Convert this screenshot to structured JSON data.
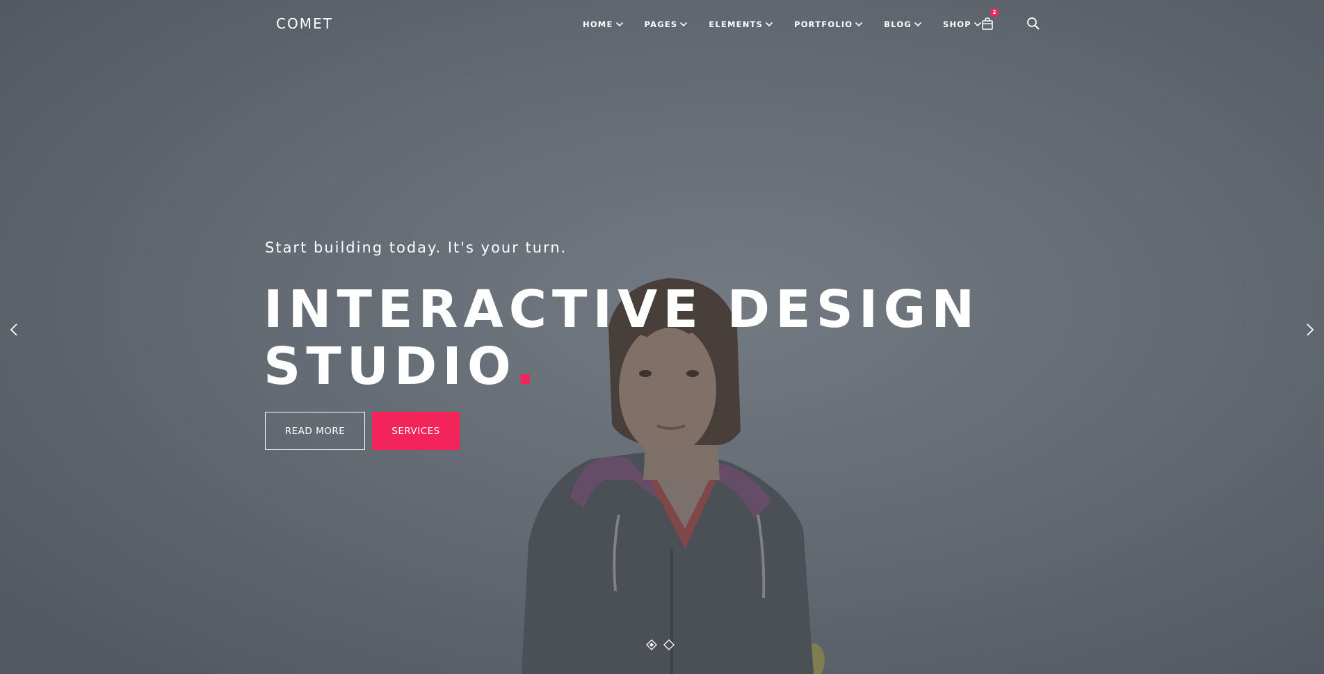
{
  "header": {
    "logo": "COMET",
    "nav": [
      {
        "label": "HOME"
      },
      {
        "label": "PAGES"
      },
      {
        "label": "ELEMENTS"
      },
      {
        "label": "PORTFOLIO"
      },
      {
        "label": "BLOG"
      },
      {
        "label": "SHOP"
      }
    ],
    "cart_count": "2",
    "cart_icon": "shopping-bag-icon",
    "search_icon": "search-icon"
  },
  "hero": {
    "tagline": "Start building today. It's your turn.",
    "headline_line1": "INTERACTIVE DESIGN",
    "headline_line2": "STUDIO",
    "headline_dot": ".",
    "read_more_label": "READ MORE",
    "services_label": "SERVICES"
  },
  "slider": {
    "prev_icon": "chevron-left-icon",
    "next_icon": "chevron-right-icon",
    "slides": 2,
    "active_slide": 1
  },
  "colors": {
    "accent": "#f2245a",
    "text": "#ffffff",
    "background": "#6c737c"
  }
}
